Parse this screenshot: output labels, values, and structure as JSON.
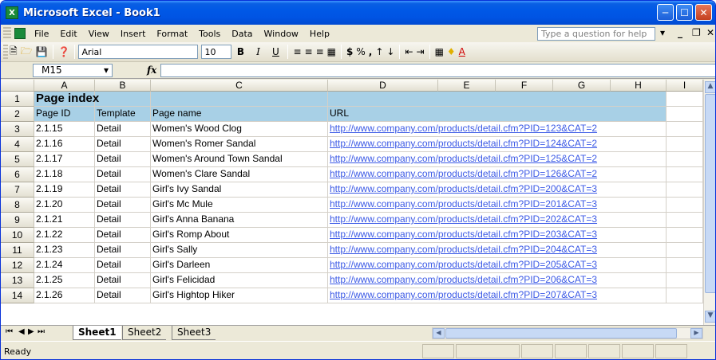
{
  "window": {
    "title": "Microsoft Excel - Book1",
    "app_icon_glyph": "X"
  },
  "menubar": {
    "items": [
      "File",
      "Edit",
      "View",
      "Insert",
      "Format",
      "Tools",
      "Data",
      "Window",
      "Help"
    ],
    "help_placeholder": "Type a question for help"
  },
  "toolbar": {
    "font": "Arial",
    "size": "10",
    "bold": "B",
    "italic": "I",
    "underline": "U",
    "currency": "$",
    "percent": "%",
    "comma": ","
  },
  "formula": {
    "name_box": "M15",
    "fx": "fx",
    "value": ""
  },
  "columns": [
    "A",
    "B",
    "C",
    "D",
    "E",
    "F",
    "G",
    "H",
    "I"
  ],
  "rows": [
    {
      "n": "1",
      "a": "Page index",
      "b": "",
      "c": "",
      "d": ""
    },
    {
      "n": "2",
      "a": "Page ID",
      "b": "Template",
      "c": "Page name",
      "d": "URL"
    },
    {
      "n": "3",
      "a": "2.1.15",
      "b": "Detail",
      "c": "Women's Wood Clog",
      "d": "http://www.company.com/products/detail.cfm?PID=123&CAT=2"
    },
    {
      "n": "4",
      "a": "2.1.16",
      "b": "Detail",
      "c": "Women's Romer Sandal",
      "d": "http://www.company.com/products/detail.cfm?PID=124&CAT=2"
    },
    {
      "n": "5",
      "a": "2.1.17",
      "b": "Detail",
      "c": "Women's Around Town Sandal",
      "d": "http://www.company.com/products/detail.cfm?PID=125&CAT=2"
    },
    {
      "n": "6",
      "a": "2.1.18",
      "b": "Detail",
      "c": "Women's Clare Sandal",
      "d": "http://www.company.com/products/detail.cfm?PID=126&CAT=2"
    },
    {
      "n": "7",
      "a": "2.1.19",
      "b": "Detail",
      "c": "Girl's Ivy Sandal",
      "d": "http://www.company.com/products/detail.cfm?PID=200&CAT=3"
    },
    {
      "n": "8",
      "a": "2.1.20",
      "b": "Detail",
      "c": "Girl's Mc Mule",
      "d": "http://www.company.com/products/detail.cfm?PID=201&CAT=3"
    },
    {
      "n": "9",
      "a": "2.1.21",
      "b": "Detail",
      "c": "Girl's Anna Banana",
      "d": "http://www.company.com/products/detail.cfm?PID=202&CAT=3"
    },
    {
      "n": "10",
      "a": "2.1.22",
      "b": "Detail",
      "c": "Girl's Romp About",
      "d": "http://www.company.com/products/detail.cfm?PID=203&CAT=3"
    },
    {
      "n": "11",
      "a": "2.1.23",
      "b": "Detail",
      "c": "Girl's Sally",
      "d": "http://www.company.com/products/detail.cfm?PID=204&CAT=3"
    },
    {
      "n": "12",
      "a": "2.1.24",
      "b": "Detail",
      "c": "Girl's Darleen",
      "d": "http://www.company.com/products/detail.cfm?PID=205&CAT=3"
    },
    {
      "n": "13",
      "a": "2.1.25",
      "b": "Detail",
      "c": "Girl's Felicidad",
      "d": "http://www.company.com/products/detail.cfm?PID=206&CAT=3"
    },
    {
      "n": "14",
      "a": "2.1.26",
      "b": "Detail",
      "c": "Girl's Hightop Hiker",
      "d": "http://www.company.com/products/detail.cfm?PID=207&CAT=3"
    }
  ],
  "sheets": [
    "Sheet1",
    "Sheet2",
    "Sheet3"
  ],
  "status": {
    "text": "Ready"
  },
  "colors": {
    "header_fill": "#a8d0e6",
    "link": "#3c5ae6",
    "titlebar": "#0054e3"
  }
}
